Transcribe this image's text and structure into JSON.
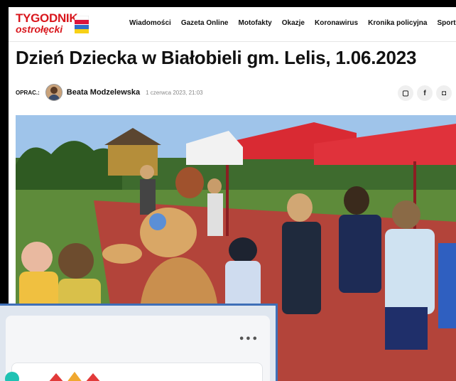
{
  "site": {
    "logo_line1": "TYGODNIK",
    "logo_line2": "ostrołęcki"
  },
  "nav": {
    "items": [
      "Wiadomości",
      "Gazeta Online",
      "Motofakty",
      "Okazje",
      "Koronawirus",
      "Kronika policyjna",
      "Sport"
    ]
  },
  "article": {
    "title": "Dzień Dziecka w Białobieli gm. Lelis, 1.06.2023",
    "byline_label": "OPRAC.:",
    "author": "Beata Modzelewska",
    "date": "1 czerwca 2023, 21:03"
  },
  "share": {
    "icons": [
      "comment-icon",
      "facebook-icon",
      "flipboard-icon"
    ],
    "glyphs": [
      "▢",
      "f",
      "◘"
    ]
  },
  "overlay": {
    "menu_glyph": "•••"
  },
  "colors": {
    "brand_red": "#d9171d",
    "overlay_border": "#3f6fb7",
    "tent_red": "#d92a33"
  }
}
